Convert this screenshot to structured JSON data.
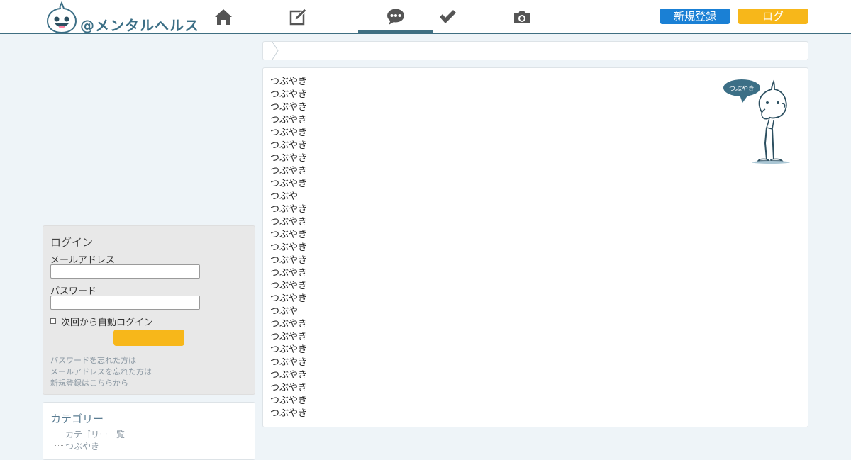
{
  "header": {
    "logo_text": "@メンタルヘルス",
    "nav": [
      {
        "icon": "home-icon"
      },
      {
        "icon": "edit-icon"
      },
      {
        "icon": "chat-bubble-icon",
        "active": true
      },
      {
        "icon": "checkmark-icon"
      },
      {
        "icon": "camera-icon"
      }
    ],
    "register_label": "新規登録",
    "login_label": "ログ"
  },
  "main": {
    "mascot_bubble_text": "つぶやき",
    "tweets": [
      "つぶやき",
      "つぶやき",
      "つぶやき",
      "つぶやき",
      "つぶやき",
      "つぶやき",
      "つぶやき",
      "つぶやき",
      "つぶやき",
      "つぶや",
      "つぶやき",
      "つぶやき",
      "つぶやき",
      "つぶやき",
      "つぶやき",
      "つぶやき",
      "つぶやき",
      "つぶやき",
      "つぶや",
      "つぶやき",
      "つぶやき",
      "つぶやき",
      "つぶやき",
      "つぶやき",
      "つぶやき",
      "つぶやき",
      "つぶやき"
    ]
  },
  "login_box": {
    "title": "ログイン",
    "id_label": "メールアドレス",
    "password_label": "パスワード",
    "remember_label": "次回から自動ログイン",
    "submit_label": "",
    "links": [
      "パスワードを忘れた方は",
      "メールアドレスを忘れた方は",
      "新規登録はこちらから"
    ]
  },
  "categories": {
    "title": "カテゴリー",
    "items": [
      "カテゴリー一覧",
      "つぶやき"
    ]
  },
  "colors": {
    "accent": "#3f6f82",
    "register_button": "#1a80d5",
    "login_button": "#f7b71a",
    "page_background": "#eef4f8"
  }
}
